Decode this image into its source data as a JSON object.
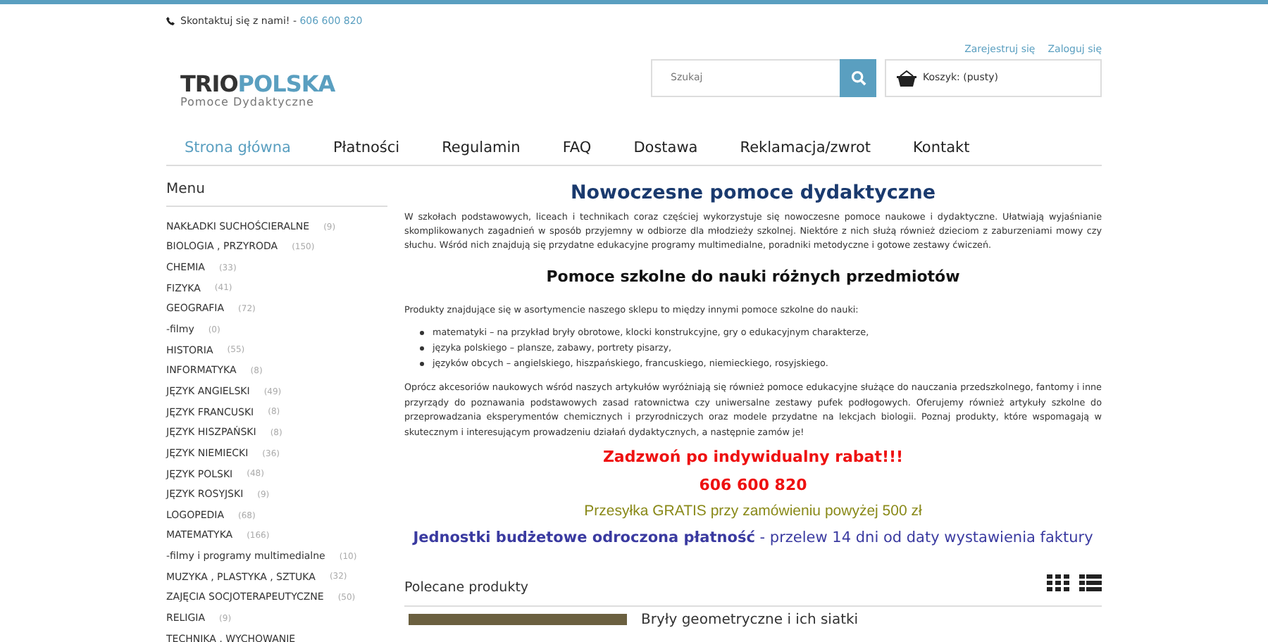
{
  "contact": {
    "label": "Skontaktuj się z nami! - ",
    "phone": "606 600 820"
  },
  "account_links": [
    "Zarejestruj się",
    "Zaloguj się"
  ],
  "logo": {
    "part_1": "TRIO",
    "part_2": "POLSKA",
    "tagline": "Pomoce Dydaktyczne"
  },
  "search": {
    "placeholder": "Szukaj"
  },
  "cart": {
    "label": "Koszyk: (pusty)"
  },
  "nav": [
    {
      "label": "Strona główna",
      "selected": true
    },
    {
      "label": "Płatności",
      "selected": false
    },
    {
      "label": "Regulamin",
      "selected": false
    },
    {
      "label": "FAQ",
      "selected": false
    },
    {
      "label": "Dostawa",
      "selected": false
    },
    {
      "label": "Reklamacja/zwrot",
      "selected": false
    },
    {
      "label": "Kontakt",
      "selected": false
    }
  ],
  "sidebar": {
    "title": "Menu",
    "items": [
      {
        "label": "NAKŁADKI SUCHOŚCIERALNE",
        "count": "(9)"
      },
      {
        "label": "BIOLOGIA , PRZYRODA",
        "count": "(150)"
      },
      {
        "label": "CHEMIA",
        "count": "(33)"
      },
      {
        "label": "FIZYKA",
        "count": "(41)"
      },
      {
        "label": "GEOGRAFIA",
        "count": "(72)"
      },
      {
        "label": "-filmy",
        "count": "(0)"
      },
      {
        "label": "HISTORIA",
        "count": "(55)"
      },
      {
        "label": "INFORMATYKA",
        "count": "(8)"
      },
      {
        "label": "JĘZYK ANGIELSKI",
        "count": "(49)"
      },
      {
        "label": "JĘZYK FRANCUSKI",
        "count": "(8)"
      },
      {
        "label": "JĘZYK HISZPAŃSKI",
        "count": "(8)"
      },
      {
        "label": "JĘZYK NIEMIECKI",
        "count": "(36)"
      },
      {
        "label": "JĘZYK POLSKI",
        "count": "(48)"
      },
      {
        "label": "JĘZYK ROSYJSKI",
        "count": "(9)"
      },
      {
        "label": "LOGOPEDIA",
        "count": "(68)"
      },
      {
        "label": "MATEMATYKA",
        "count": "(166)"
      },
      {
        "label": "-filmy i programy multimedialne",
        "count": "(10)"
      },
      {
        "label": "MUZYKA , PLASTYKA , SZTUKA",
        "count": "(32)"
      },
      {
        "label": "ZAJĘCIA SOCJOTERAPEUTYCZNE",
        "count": "(50)"
      },
      {
        "label": "RELIGIA",
        "count": "(9)"
      },
      {
        "label": "TECHNIKA , WYCHOWANIE"
      }
    ]
  },
  "main": {
    "title": "Nowoczesne pomoce dydaktyczne",
    "intro": "W szkołach podstawowych, liceach i technikach coraz częściej wykorzystuje się nowoczesne pomoce naukowe i dydaktyczne. Ułatwiają wyjaśnianie skomplikowanych zagadnień w sposób przyjemny w odbiorze dla młodzieży szkolnej. Niektóre z nich służą również dzieciom z zaburzeniami mowy czy słuchu. Wśród nich znajdują się przydatne edukacyjne programy multimedialne, poradniki metodyczne i gotowe zestawy ćwiczeń.",
    "subtitle": "Pomoce szkolne do nauki różnych przedmiotów",
    "lead": "Produkty znajdujące się w asortymencie naszego sklepu to między innymi pomoce szkolne do nauki:",
    "bullets": [
      "matematyki – na przykład bryły obrotowe, klocki konstrukcyjne, gry o edukacyjnym charakterze,",
      "języka polskiego – plansze, zabawy, portrety pisarzy,",
      "języków obcych – angielskiego, hiszpańskiego, francuskiego, niemieckiego, rosyjskiego."
    ],
    "body": "Oprócz akcesoriów naukowych wśród naszych artykułów wyróżniają się również pomoce edukacyjne służące do nauczania przedszkolnego, fantomy i inne przyrządy do poznawania podstawowych zasad ratownictwa czy uniwersalne zestawy pufek podłogowych. Oferujemy również artykuły szkolne do przeprowadzania eksperymentów chemicznych i przyrodniczych oraz modele przydatne na lekcjach biologii. Poznaj produkty, które wspomagają w skutecznym i interesującym prowadzeniu działań dydaktycznych, a następnie zamów je!",
    "promos": [
      {
        "kind": "discount",
        "text": "Zadzwoń po indywidualny rabat!!!"
      },
      {
        "kind": "discount",
        "text": "606 600 820"
      },
      {
        "kind": "shipping",
        "text": "Przesyłka GRATIS przy zamówieniu powyżej 500 zł"
      },
      {
        "kind": "budget",
        "text": "**Jednostki budżetowe odroczona płatność** - przelew 14 dni od daty wystawienia faktury"
      }
    ]
  },
  "featured": {
    "title": "Polecane produkty",
    "products": [
      {
        "name": "Bryły geometryczne i ich siatki"
      }
    ]
  }
}
